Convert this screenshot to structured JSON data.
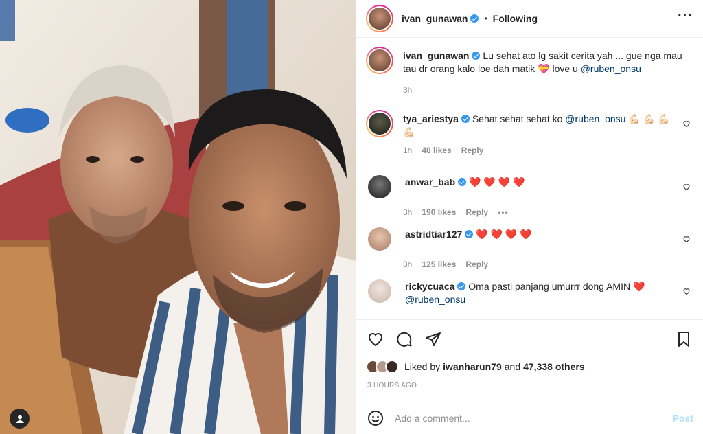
{
  "header": {
    "username": "ivan_gunawan",
    "separator": "•",
    "follow_status": "Following"
  },
  "caption": {
    "username": "ivan_gunawan",
    "text": "Lu sehat ato lg sakit cerita yah ... gue nga mau tau dr orang kalo loe dah matik",
    "emoji": "💝",
    "text2": "love u",
    "mention": "@ruben_onsu",
    "time": "3h"
  },
  "comments": [
    {
      "username": "tya_ariestya",
      "verified": true,
      "text": "Sehat sehat sehat ko",
      "mention": "@ruben_onsu",
      "emoji": "💪🏻 💪🏻 💪🏻 💪🏻",
      "time": "1h",
      "likes": "48 likes",
      "reply": "Reply"
    },
    {
      "username": "anwar_bab",
      "verified": true,
      "text": "❤️ ❤️ ❤️ ❤️",
      "time": "3h",
      "likes": "190 likes",
      "reply": "Reply",
      "more": "•••"
    },
    {
      "username": "astridtiar127",
      "verified": true,
      "text": "❤️ ❤️ ❤️ ❤️",
      "time": "3h",
      "likes": "125 likes",
      "reply": "Reply"
    },
    {
      "username": "rickycuaca",
      "verified": true,
      "text": "Oma pasti panjang umurrr dong AMIN",
      "emoji": "❤️",
      "mention": "@ruben_onsu"
    }
  ],
  "likes": {
    "prefix": "Liked by",
    "user": "iwanharun79",
    "and": "and",
    "others": "47,338 others"
  },
  "timestamp": "3 HOURS AGO",
  "add_comment": {
    "placeholder": "Add a comment...",
    "post_label": "Post"
  },
  "icons": {
    "like": "heart-icon",
    "comment": "comment-icon",
    "share": "paper-plane-icon",
    "save": "bookmark-icon",
    "emoji": "smiley-icon",
    "more": "more-dots-icon"
  }
}
